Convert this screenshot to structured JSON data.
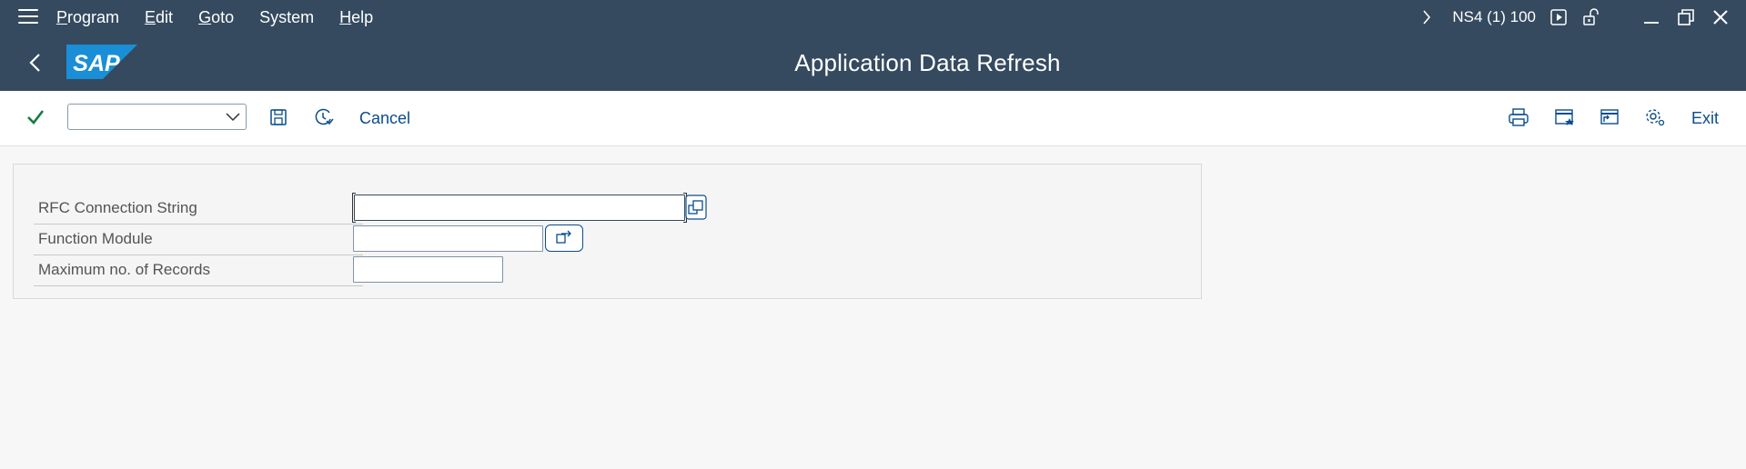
{
  "menu": {
    "items": [
      {
        "accel": "P",
        "rest": "rogram"
      },
      {
        "accel": "E",
        "rest": "dit"
      },
      {
        "accel": "G",
        "rest": "oto"
      },
      {
        "accel": "",
        "rest": "System"
      },
      {
        "accel": "H",
        "rest": "elp"
      }
    ],
    "system_info": "NS4 (1) 100"
  },
  "title": {
    "text": "Application Data Refresh",
    "logo_text": "SAP"
  },
  "toolbar": {
    "command_field_value": "",
    "cancel_label": "Cancel",
    "exit_label": "Exit"
  },
  "form": {
    "fields": [
      {
        "label": "RFC Connection String",
        "value": ""
      },
      {
        "label": "Function Module",
        "value": ""
      },
      {
        "label": "Maximum no. of Records",
        "value": ""
      }
    ]
  },
  "colors": {
    "shell_header": "#354a5f",
    "link_blue": "#0a4d8c",
    "check_green": "#107e3e",
    "logo_blue": "#1a8ed6"
  }
}
